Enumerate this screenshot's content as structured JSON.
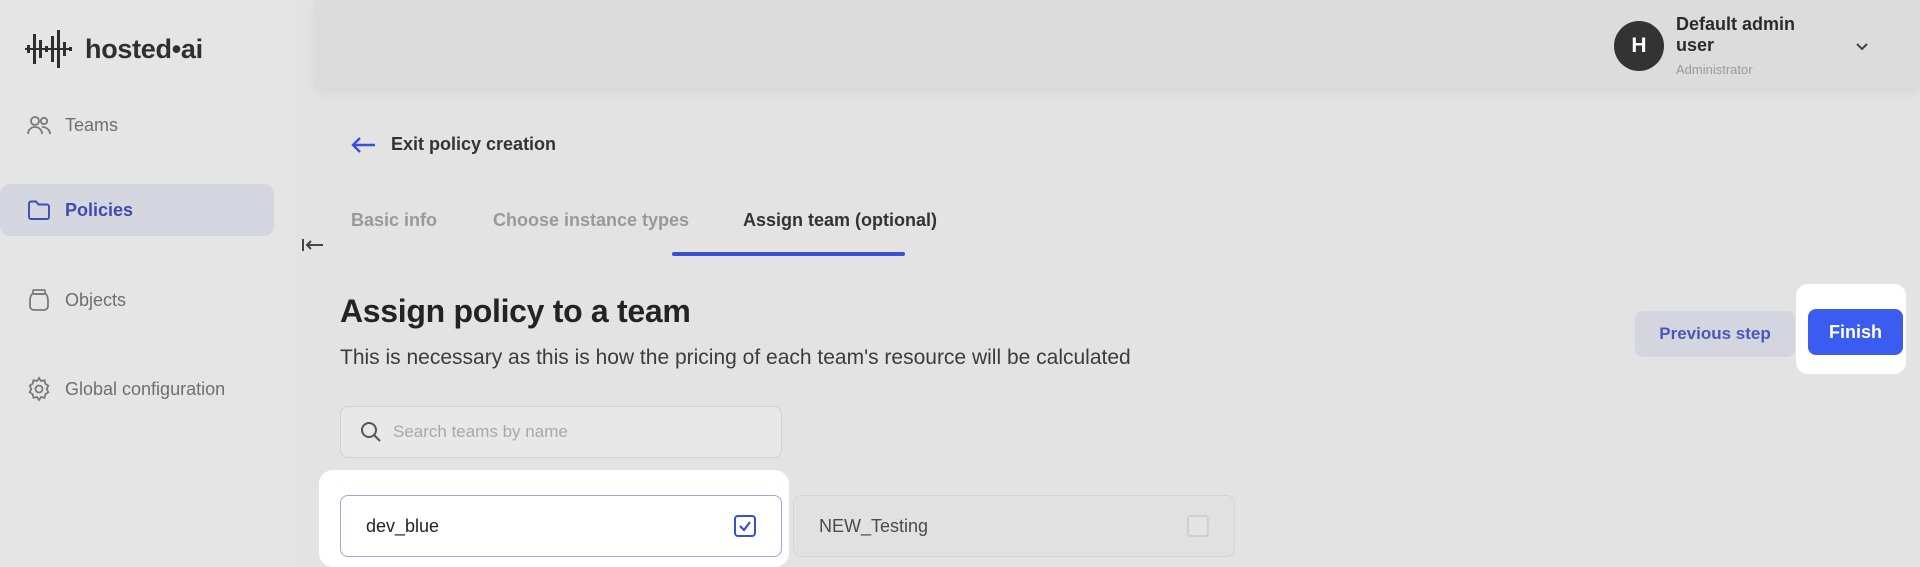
{
  "brand": {
    "name": "hosted•ai"
  },
  "sidebar": {
    "items": [
      {
        "label": "Teams",
        "icon": "users-icon",
        "active": false
      },
      {
        "label": "Policies",
        "icon": "folder-icon",
        "active": true
      },
      {
        "label": "Objects",
        "icon": "jar-icon",
        "active": false
      },
      {
        "label": "Global configuration",
        "icon": "gear-icon",
        "active": false
      }
    ]
  },
  "header": {
    "user": {
      "initial": "H",
      "name": "Default admin user",
      "role": "Administrator"
    }
  },
  "main": {
    "exit_label": "Exit policy creation",
    "tabs": [
      {
        "label": "Basic info",
        "active": false
      },
      {
        "label": "Choose instance types",
        "active": false
      },
      {
        "label": "Assign team (optional)",
        "active": true
      }
    ],
    "title": "Assign policy to a team",
    "subtitle": "This is necessary as this is how the pricing of each team's resource will be calculated",
    "actions": {
      "previous_label": "Previous step",
      "finish_label": "Finish"
    },
    "search": {
      "placeholder": "Search teams by name",
      "value": ""
    },
    "teams": [
      {
        "name": "dev_blue",
        "checked": true
      },
      {
        "name": "NEW_Testing",
        "checked": false
      }
    ]
  },
  "colors": {
    "accent": "#3a5cf0",
    "active_nav_bg": "#d4d6e0",
    "active_nav_text": "#3f4bb2"
  }
}
